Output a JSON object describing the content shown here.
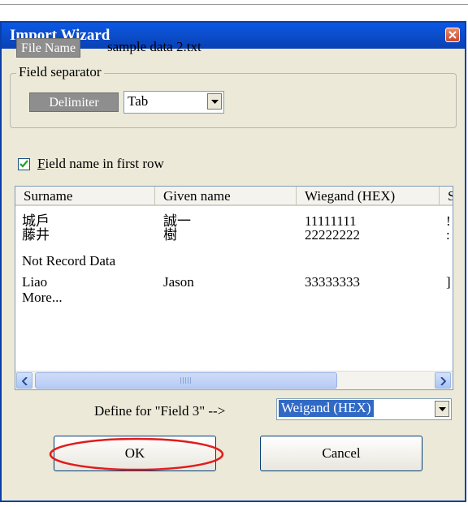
{
  "window": {
    "title": "Import Wizard"
  },
  "file": {
    "label": "File Name",
    "value": "sample data 2.txt"
  },
  "separator": {
    "group_title": "Field separator",
    "label": "Delimiter",
    "selected": "Tab"
  },
  "options": {
    "field_name_first_row": {
      "label": "ield name in first row",
      "mnemonic": "F",
      "checked": true
    }
  },
  "table": {
    "columns": [
      "Surname",
      "Given name",
      "Wiegand (HEX)",
      "S"
    ],
    "rows": [
      [
        "城戶",
        "誠一",
        "11111111",
        "!"
      ],
      [
        "藤井",
        "樹",
        "22222222",
        ":"
      ],
      [
        "Not Record Data",
        "",
        "",
        ""
      ],
      [
        "Liao",
        "Jason",
        "33333333",
        "]"
      ],
      [
        "More...",
        "",
        "",
        ""
      ]
    ],
    "scrollbar_grip": "III"
  },
  "define": {
    "label": "Define for  \"Field 3\"  -->",
    "selected": "Weigand (HEX)"
  },
  "buttons": {
    "ok": "OK",
    "cancel": "Cancel"
  },
  "colors": {
    "title_bar": "#0a58e6",
    "highlight": "#e21b1b",
    "selection": "#316ac5"
  },
  "icons": [
    "close-icon",
    "dropdown-arrow-icon",
    "checkmark-icon",
    "scroll-left-icon",
    "scroll-right-icon"
  ]
}
